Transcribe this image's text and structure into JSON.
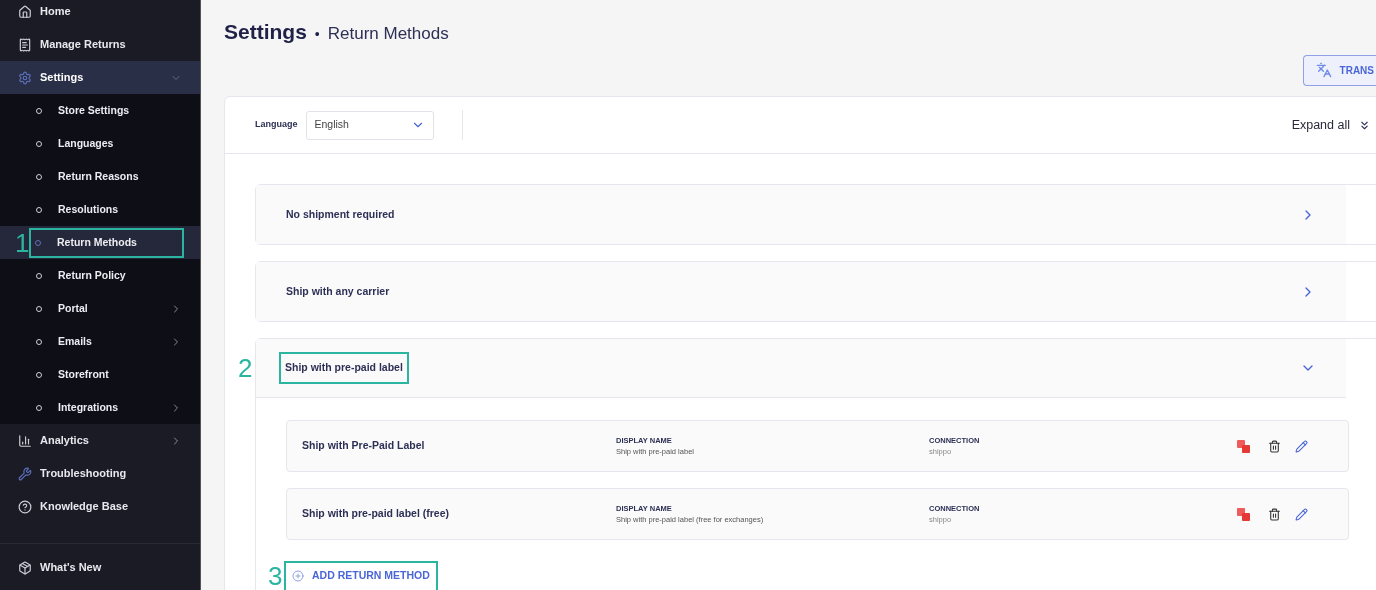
{
  "sidebar": {
    "items": [
      {
        "label": "Home",
        "selected": false
      },
      {
        "label": "Manage Returns",
        "selected": false
      },
      {
        "label": "Settings",
        "selected": true,
        "expanded": true,
        "children": [
          {
            "label": "Store Settings",
            "selected": false,
            "has_submenu": false
          },
          {
            "label": "Languages",
            "selected": false,
            "has_submenu": false
          },
          {
            "label": "Return Reasons",
            "selected": false,
            "has_submenu": false
          },
          {
            "label": "Resolutions",
            "selected": false,
            "has_submenu": false
          },
          {
            "label": "Return Methods",
            "selected": true,
            "has_submenu": false,
            "callout": "1"
          },
          {
            "label": "Return Policy",
            "selected": false,
            "has_submenu": false
          },
          {
            "label": "Portal",
            "selected": false,
            "has_submenu": true
          },
          {
            "label": "Emails",
            "selected": false,
            "has_submenu": true
          },
          {
            "label": "Storefront",
            "selected": false,
            "has_submenu": false
          },
          {
            "label": "Integrations",
            "selected": false,
            "has_submenu": true
          }
        ]
      },
      {
        "label": "Analytics",
        "selected": false,
        "expanded": false
      },
      {
        "label": "Troubleshooting",
        "selected": false
      },
      {
        "label": "Knowledge Base",
        "selected": false
      }
    ],
    "footer": {
      "label": "What's New"
    }
  },
  "header": {
    "title": "Settings",
    "separator": "•",
    "subtitle": "Return Methods",
    "translate_button": "TRANS"
  },
  "toolbar": {
    "language_label": "Language",
    "language_value": "English",
    "expand_all": "Expand all"
  },
  "sections": [
    {
      "title": "No shipment required",
      "expanded": false
    },
    {
      "title": "Ship with any carrier",
      "expanded": false
    },
    {
      "title": "Ship with pre-paid label",
      "expanded": true,
      "callout": "2",
      "methods": [
        {
          "name": "Ship with Pre-Paid Label",
          "display_label": "DISPLAY NAME",
          "display_value": "Ship with pre-paid label",
          "connection_label": "CONNECTION",
          "connection_value": "shippo"
        },
        {
          "name": "Ship with pre-paid label (free)",
          "display_label": "DISPLAY NAME",
          "display_value": "Ship with pre-paid label (free for exchanges)",
          "connection_label": "CONNECTION",
          "connection_value": "shippo"
        }
      ],
      "add_button": {
        "label": "ADD RETURN METHOD",
        "callout": "3"
      }
    }
  ]
}
